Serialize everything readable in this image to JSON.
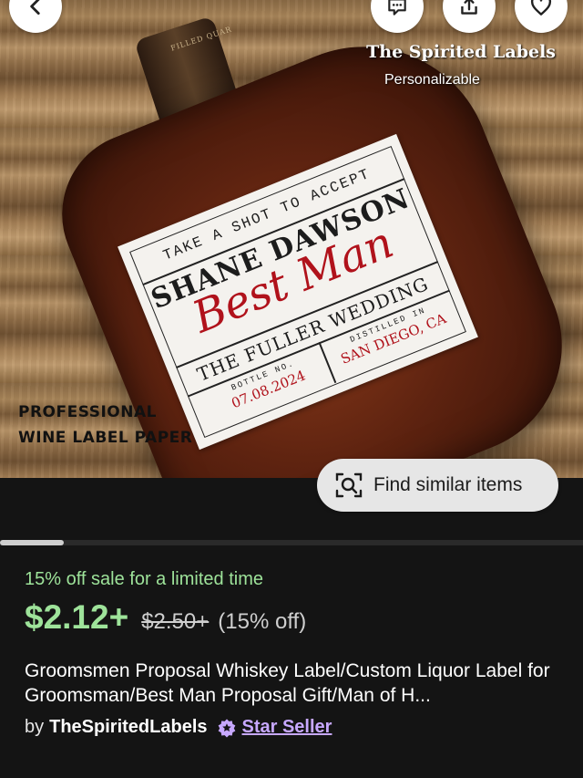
{
  "image": {
    "brand_title": "The Spirited Labels",
    "brand_subtitle": "Personalizable",
    "paper_line1": "PROFESSIONAL",
    "paper_line2": "WINE LABEL PAPER",
    "cap_text": "FILLED QUAR",
    "label": {
      "top": "TAKE A SHOT TO ACCEPT",
      "name": "SHANE DAWSON",
      "role": "Best Man",
      "wedding": "THE FULLER WEDDING",
      "bottle_no_label": "BOTTLE NO.",
      "date": "07.08.2024",
      "distilled_label": "DISTILLED IN",
      "place": "SAN DIEGO, CA"
    }
  },
  "find_similar": {
    "label": "Find similar items",
    "icon": "search-icon"
  },
  "top_buttons": [
    {
      "icon": "back-chevron-icon"
    },
    {
      "icon": "message-icon"
    },
    {
      "icon": "share-icon"
    },
    {
      "icon": "heart-icon"
    }
  ],
  "gallery": {
    "progress": 0.11
  },
  "listing": {
    "sale_text": "15% off sale for a limited time",
    "price": "$2.12+",
    "original_price": "$2.50+",
    "discount": "(15% off)",
    "title": "Groomsmen Proposal Whiskey Label/Custom Liquor Label for Groomsman/Best Man Proposal Gift/Man of H...",
    "by": "by",
    "shop": "TheSpiritedLabels",
    "star_seller": "Star Seller"
  },
  "colors": {
    "accent_green": "#9ee39a",
    "star_seller_purple": "#c7a8ff",
    "background": "#141414"
  }
}
